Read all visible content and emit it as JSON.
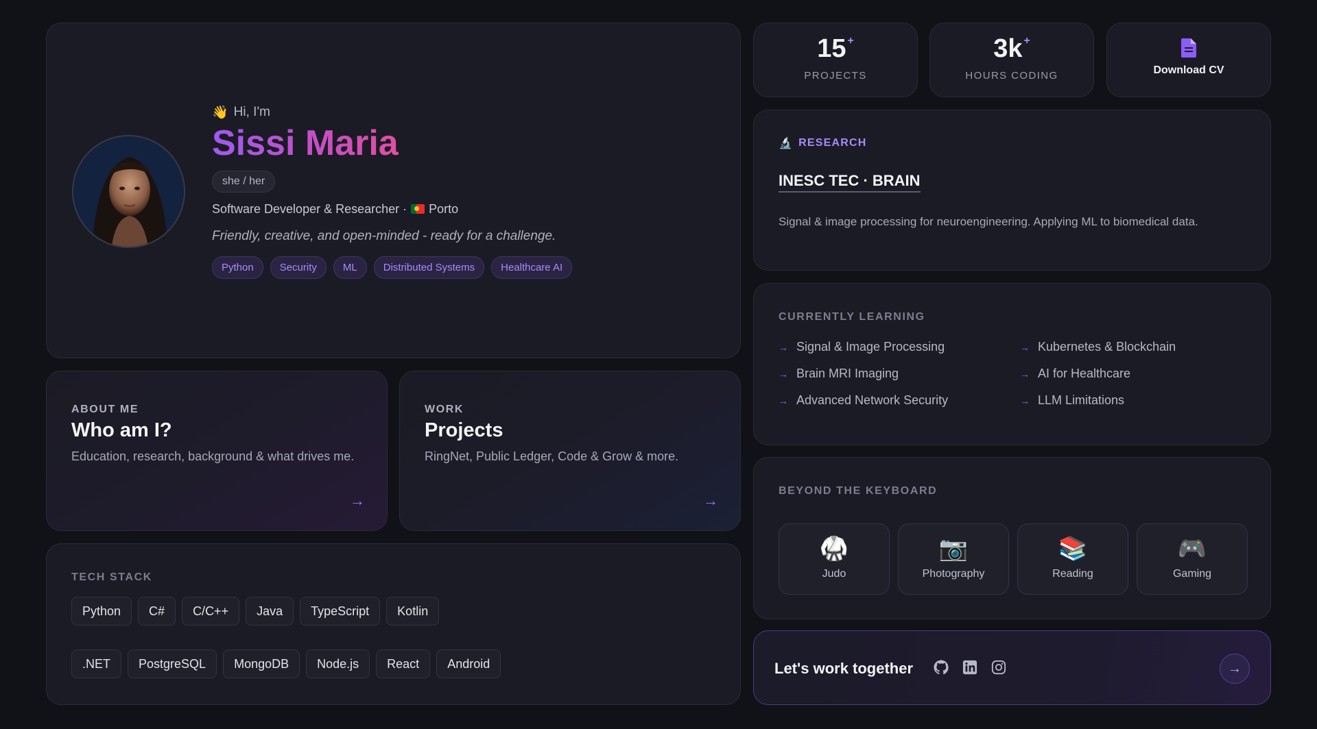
{
  "hero": {
    "greeting": "Hi, I'm",
    "name": "Sissi Maria",
    "pronouns": "she / her",
    "role": "Software Developer & Researcher ·",
    "location": "Porto",
    "tagline": "Friendly, creative, and open-minded - ready for a challenge.",
    "tags": [
      "Python",
      "Security",
      "ML",
      "Distributed Systems",
      "Healthcare AI"
    ]
  },
  "stats": {
    "projects": {
      "value": "15",
      "suffix": "+",
      "label": "PROJECTS"
    },
    "hours": {
      "value": "3k",
      "suffix": "+",
      "label": "HOURS CODING"
    },
    "download_cv": "Download CV"
  },
  "research": {
    "label": "RESEARCH",
    "title": "INESC TEC · BRAIN",
    "description": "Signal & image processing for neuroengineering. Applying ML to biomedical data."
  },
  "learning": {
    "label": "CURRENTLY LEARNING",
    "items": [
      "Signal & Image Processing",
      "Kubernetes & Blockchain",
      "Brain MRI Imaging",
      "AI for Healthcare",
      "Advanced Network Security",
      "LLM Limitations"
    ]
  },
  "beyond": {
    "label": "BEYOND THE KEYBOARD",
    "hobbies": [
      {
        "label": "Judo",
        "icon": "judo-gi-icon"
      },
      {
        "label": "Photography",
        "icon": "camera-icon"
      },
      {
        "label": "Reading",
        "icon": "books-icon"
      },
      {
        "label": "Gaming",
        "icon": "gamepad-icon"
      }
    ]
  },
  "cta": {
    "title": "Let's work together",
    "socials": [
      "github-icon",
      "linkedin-icon",
      "instagram-icon"
    ]
  },
  "about": {
    "label": "ABOUT ME",
    "title": "Who am I?",
    "description": "Education, research, background & what drives me."
  },
  "work": {
    "label": "WORK",
    "title": "Projects",
    "description": "RingNet, Public Ledger, Code & Grow & more."
  },
  "tech": {
    "label": "TECH STACK",
    "row1": [
      "Python",
      "C#",
      "C/C++",
      "Java",
      "TypeScript",
      "Kotlin"
    ],
    "row2": [
      ".NET",
      "PostgreSQL",
      "MongoDB",
      "Node.js",
      "React",
      "Android"
    ]
  },
  "colors": {
    "accent": "#a78bfa",
    "background": "#111118",
    "card": "#1b1b25"
  }
}
